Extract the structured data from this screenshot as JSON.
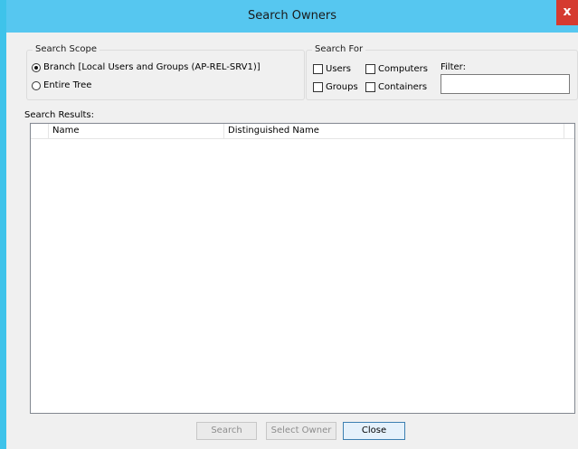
{
  "window": {
    "title": "Search Owners",
    "close_glyph": "x"
  },
  "search_scope": {
    "legend": "Search Scope",
    "options": [
      {
        "label": "Branch [Local Users and Groups (AP-REL-SRV1)]",
        "selected": true
      },
      {
        "label": "Entire Tree",
        "selected": false
      }
    ]
  },
  "search_for": {
    "legend": "Search For",
    "checkboxes": {
      "users": {
        "label": "Users",
        "checked": false
      },
      "computers": {
        "label": "Computers",
        "checked": false
      },
      "groups": {
        "label": "Groups",
        "checked": false
      },
      "containers": {
        "label": "Containers",
        "checked": false
      }
    },
    "filter_label": "Filter:",
    "filter_value": ""
  },
  "results": {
    "label": "Search Results:",
    "columns": [
      "Name",
      "Distinguished Name"
    ],
    "rows": []
  },
  "buttons": {
    "search": {
      "label": "Search",
      "enabled": false
    },
    "select_owner": {
      "label": "Select Owner",
      "enabled": false
    },
    "close": {
      "label": "Close",
      "enabled": true
    }
  },
  "colors": {
    "titlebar": "#56c7f0",
    "window_border": "#3ec3ea",
    "close_button": "#d53b30",
    "dialog_background": "#f0f0f0"
  }
}
